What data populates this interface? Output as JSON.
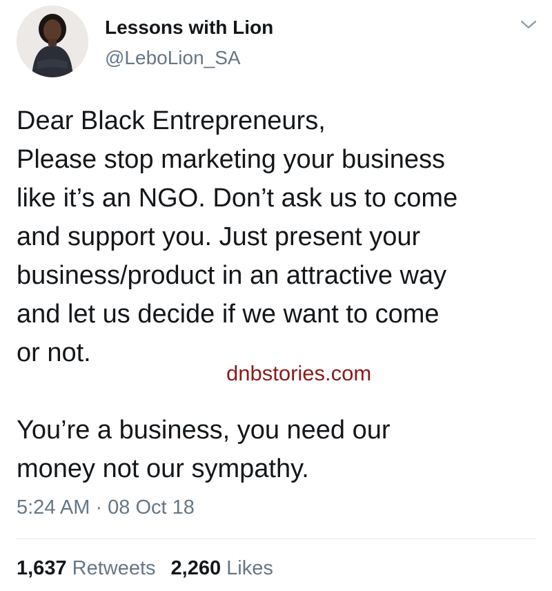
{
  "user": {
    "display_name": "Lessons with Lion",
    "handle": "@LeboLion_SA"
  },
  "tweet": {
    "paragraph_1": "Dear Black Entrepreneurs,\nPlease stop marketing your business\nlike it’s an NGO. Don’t ask us to come\nand support you. Just present your\nbusiness/product in an attractive way\nand let us decide if we want to come\nor not.",
    "paragraph_2": "You’re a business, you need our\nmoney not our sympathy.",
    "timestamp": "5:24 AM · 08 Oct 18"
  },
  "watermark": "dnbstories.com",
  "stats": {
    "retweets_count": "1,637",
    "retweets_label": "Retweets",
    "likes_count": "2,260",
    "likes_label": "Likes"
  },
  "icons": {
    "menu": "chevron-down-icon"
  },
  "colors": {
    "text": "#14171a",
    "secondary": "#657786",
    "watermark": "#8b1a1a",
    "divider": "#e1e8ed"
  }
}
